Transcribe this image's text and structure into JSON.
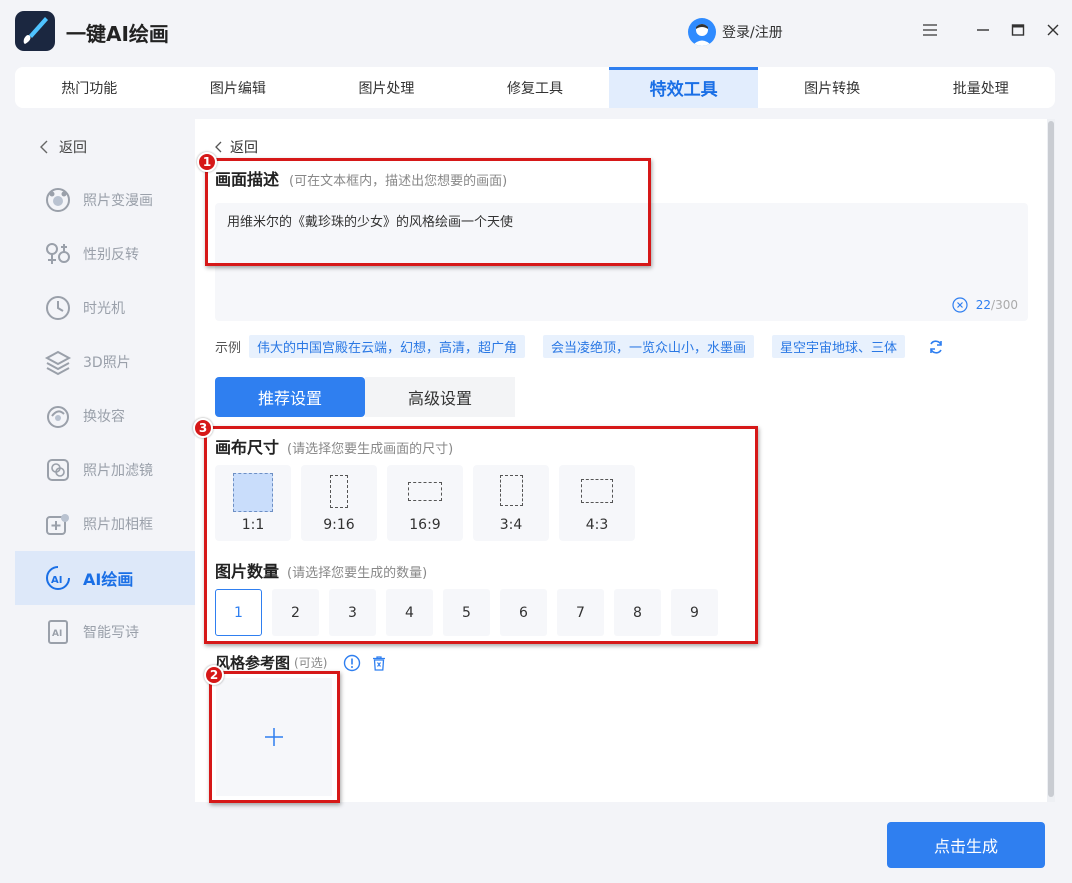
{
  "app": {
    "title": "一键AI绘画",
    "login_text": "登录/注册"
  },
  "tabs": [
    {
      "label": "热门功能"
    },
    {
      "label": "图片编辑"
    },
    {
      "label": "图片处理"
    },
    {
      "label": "修复工具"
    },
    {
      "label": "特效工具",
      "active": true
    },
    {
      "label": "图片转换"
    },
    {
      "label": "批量处理"
    }
  ],
  "sidebar": {
    "back_label": "返回",
    "items": [
      {
        "label": "照片变漫画",
        "icon": "bear-face-icon"
      },
      {
        "label": "性别反转",
        "icon": "gender-icon"
      },
      {
        "label": "时光机",
        "icon": "clock-icon"
      },
      {
        "label": "3D照片",
        "icon": "layers-icon"
      },
      {
        "label": "换妆容",
        "icon": "makeup-icon"
      },
      {
        "label": "照片加滤镜",
        "icon": "filter-icon"
      },
      {
        "label": "照片加相框",
        "icon": "frame-icon"
      },
      {
        "label": "AI绘画",
        "icon": "ai-paint-icon",
        "active": true
      },
      {
        "label": "智能写诗",
        "icon": "ai-poem-icon"
      }
    ]
  },
  "main": {
    "back_label": "返回",
    "description": {
      "title": "画面描述",
      "hint": "(可在文本框内，描述出您想要的画面)",
      "value": "用维米尔的《戴珍珠的少女》的风格绘画一个天使",
      "count_current": "22",
      "count_max": "/300"
    },
    "examples": {
      "label": "示例",
      "chips": [
        "伟大的中国宫殿在云端，幻想，高清，超广角",
        "会当凌绝顶，一览众山小，水墨画",
        "星空宇宙地球、三体"
      ]
    },
    "settings_tabs": [
      {
        "label": "推荐设置",
        "active": true
      },
      {
        "label": "高级设置"
      }
    ],
    "canvas_size": {
      "title": "画布尺寸",
      "hint": "(请选择您要生成画面的尺寸)",
      "options": [
        "1:1",
        "9:16",
        "16:9",
        "3:4",
        "4:3"
      ],
      "selected": "1:1"
    },
    "image_count": {
      "title": "图片数量",
      "hint": "(请选择您要生成的数量)",
      "options": [
        "1",
        "2",
        "3",
        "4",
        "5",
        "6",
        "7",
        "8",
        "9"
      ],
      "selected": "1"
    },
    "style_ref": {
      "title": "风格参考图",
      "optional": "(可选)"
    },
    "generate_label": "点击生成"
  },
  "annotations": [
    "1",
    "2",
    "3"
  ],
  "colors": {
    "accent": "#2f7ff0",
    "annotation": "#d61818"
  }
}
